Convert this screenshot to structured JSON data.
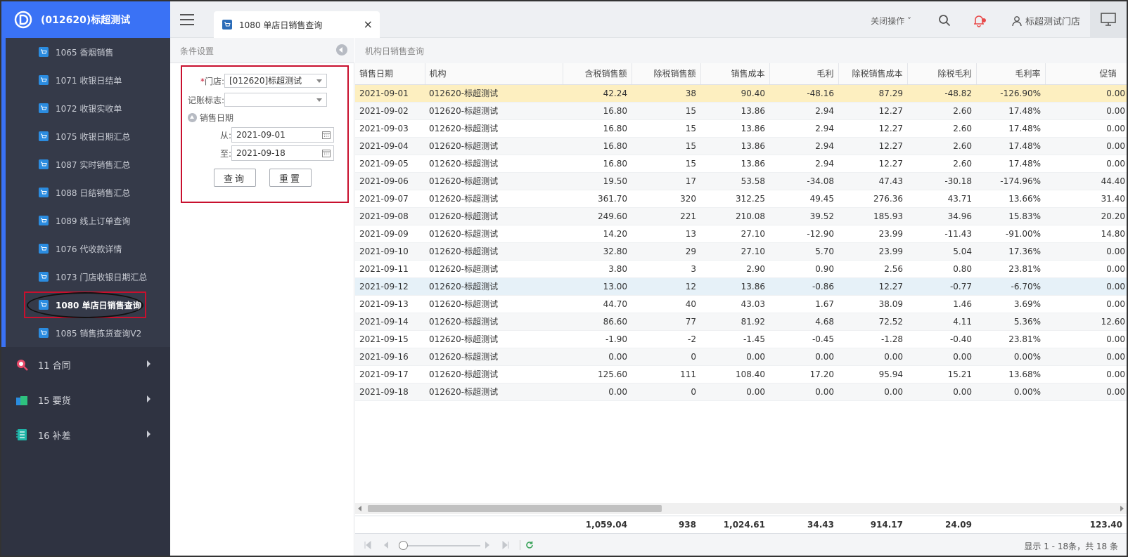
{
  "app": {
    "brand_title": "(012620)标超测试"
  },
  "sidebar": {
    "sub_items": [
      {
        "label": "1065 香烟销售"
      },
      {
        "label": "1071 收银日结单"
      },
      {
        "label": "1072 收银实收单"
      },
      {
        "label": "1075 收银日期汇总"
      },
      {
        "label": "1087 实时销售汇总"
      },
      {
        "label": "1088 日结销售汇总"
      },
      {
        "label": "1089 线上订单查询"
      },
      {
        "label": "1076 代收款详情"
      },
      {
        "label": "1073 门店收银日期汇总"
      },
      {
        "label": "1080 单店日销售查询"
      },
      {
        "label": "1085 销售拣货查询V2"
      }
    ],
    "groups": [
      {
        "label": "11 合同",
        "icon": "contract-search-icon"
      },
      {
        "label": "15 要货",
        "icon": "bag-icon"
      },
      {
        "label": "16 补差",
        "icon": "notebook-icon"
      }
    ]
  },
  "topbar": {
    "tab_label": "1080 单店日销售查询",
    "tab_close": "×",
    "close_ops": "关闭操作 ˅",
    "user_name": "标超测试门店"
  },
  "conditions": {
    "header": "条件设置",
    "store_label": "门店:",
    "store_required_mark": "*",
    "store_value": "[012620]标超测试",
    "account_flag_label": "记账标志:",
    "account_flag_value": "",
    "date_section_label": "销售日期",
    "from_label": "从:",
    "from_value": "2021-09-01",
    "to_label": "至:",
    "to_value": "2021-09-18",
    "query_button": "查询",
    "reset_button": "重置"
  },
  "grid": {
    "header": "机构日销售查询",
    "columns": [
      "销售日期",
      "机构",
      "含税销售额",
      "除税销售额",
      "销售成本",
      "毛利",
      "除税销售成本",
      "除税毛利",
      "毛利率",
      "促销"
    ],
    "rows": [
      [
        "2021-09-01",
        "012620-标超测试",
        "42.24",
        "38",
        "90.40",
        "-48.16",
        "87.29",
        "-48.82",
        "-126.90%",
        "0.00"
      ],
      [
        "2021-09-02",
        "012620-标超测试",
        "16.80",
        "15",
        "13.86",
        "2.94",
        "12.27",
        "2.60",
        "17.48%",
        "0.00"
      ],
      [
        "2021-09-03",
        "012620-标超测试",
        "16.80",
        "15",
        "13.86",
        "2.94",
        "12.27",
        "2.60",
        "17.48%",
        "0.00"
      ],
      [
        "2021-09-04",
        "012620-标超测试",
        "16.80",
        "15",
        "13.86",
        "2.94",
        "12.27",
        "2.60",
        "17.48%",
        "0.00"
      ],
      [
        "2021-09-05",
        "012620-标超测试",
        "16.80",
        "15",
        "13.86",
        "2.94",
        "12.27",
        "2.60",
        "17.48%",
        "0.00"
      ],
      [
        "2021-09-06",
        "012620-标超测试",
        "19.50",
        "17",
        "53.58",
        "-34.08",
        "47.43",
        "-30.18",
        "-174.96%",
        "44.40"
      ],
      [
        "2021-09-07",
        "012620-标超测试",
        "361.70",
        "320",
        "312.25",
        "49.45",
        "276.36",
        "43.71",
        "13.66%",
        "31.40"
      ],
      [
        "2021-09-08",
        "012620-标超测试",
        "249.60",
        "221",
        "210.08",
        "39.52",
        "185.93",
        "34.96",
        "15.83%",
        "20.20"
      ],
      [
        "2021-09-09",
        "012620-标超测试",
        "14.20",
        "13",
        "27.10",
        "-12.90",
        "23.99",
        "-11.43",
        "-91.00%",
        "14.80"
      ],
      [
        "2021-09-10",
        "012620-标超测试",
        "32.80",
        "29",
        "27.10",
        "5.70",
        "23.99",
        "5.04",
        "17.36%",
        "0.00"
      ],
      [
        "2021-09-11",
        "012620-标超测试",
        "3.80",
        "3",
        "2.90",
        "0.90",
        "2.56",
        "0.80",
        "23.81%",
        "0.00"
      ],
      [
        "2021-09-12",
        "012620-标超测试",
        "13.00",
        "12",
        "13.86",
        "-0.86",
        "12.27",
        "-0.77",
        "-6.70%",
        "0.00"
      ],
      [
        "2021-09-13",
        "012620-标超测试",
        "44.70",
        "40",
        "43.03",
        "1.67",
        "38.09",
        "1.46",
        "3.69%",
        "0.00"
      ],
      [
        "2021-09-14",
        "012620-标超测试",
        "86.60",
        "77",
        "81.92",
        "4.68",
        "72.52",
        "4.11",
        "5.36%",
        "12.60"
      ],
      [
        "2021-09-15",
        "012620-标超测试",
        "-1.90",
        "-2",
        "-1.45",
        "-0.45",
        "-1.28",
        "-0.40",
        "23.81%",
        "0.00"
      ],
      [
        "2021-09-16",
        "012620-标超测试",
        "0.00",
        "0",
        "0.00",
        "0.00",
        "0.00",
        "0.00",
        "0.00%",
        "0.00"
      ],
      [
        "2021-09-17",
        "012620-标超测试",
        "125.60",
        "111",
        "108.40",
        "17.20",
        "95.94",
        "15.21",
        "13.68%",
        "0.00"
      ],
      [
        "2021-09-18",
        "012620-标超测试",
        "0.00",
        "0",
        "0.00",
        "0.00",
        "0.00",
        "0.00",
        "0.00%",
        "0.00"
      ]
    ],
    "totals": [
      "",
      "",
      "1,059.04",
      "938",
      "1,024.61",
      "34.43",
      "914.17",
      "24.09",
      "",
      "123.40"
    ],
    "pager_info": "显示 1 - 18条，共 18 条"
  },
  "colors": {
    "brand": "#3a72f5",
    "sidebar_bg": "#2f3341",
    "highlight_box": "#c8102e",
    "selected_row": "#fdefc0"
  }
}
